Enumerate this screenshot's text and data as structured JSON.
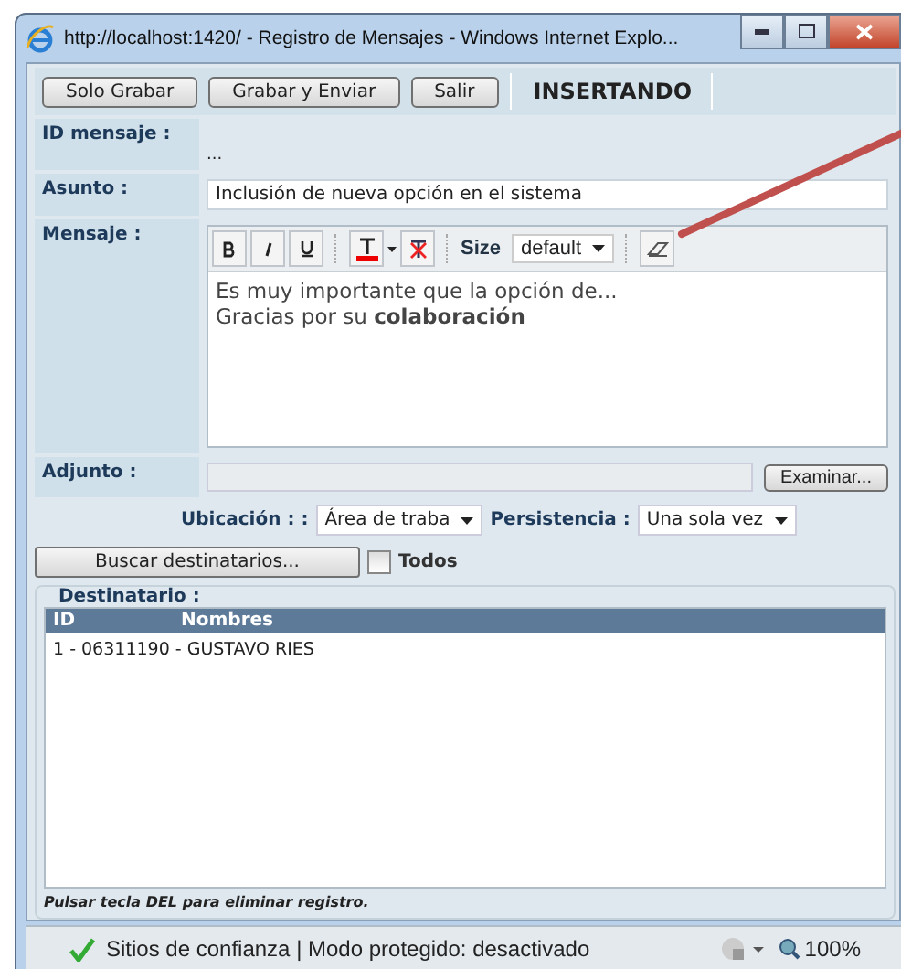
{
  "window": {
    "title": "http://localhost:1420/ - Registro de Mensajes - Windows Internet Explo..."
  },
  "toolbar": {
    "buttons": [
      "Solo Grabar",
      "Grabar y Enviar",
      "Salir"
    ],
    "mode": "INSERTANDO"
  },
  "fields": [
    {
      "label": "ID mensaje :",
      "kind": "text",
      "value": "..."
    },
    {
      "label": "Asunto :",
      "kind": "input",
      "value": "Inclusión de nueva opción en el sistema"
    },
    {
      "label": "Mensaje :",
      "kind": "editor",
      "size_label": "Size",
      "size_value": "default",
      "lines": [
        "Es muy importante que la opción de...",
        "Gracias por su **colaboración**"
      ]
    },
    {
      "label": "Adjunto :",
      "kind": "file",
      "button": "Examinar..."
    }
  ],
  "options": [
    {
      "label": "Ubicación : :",
      "value": "Área de traba"
    },
    {
      "label": "Persistencia :",
      "value": "Una sola vez"
    }
  ],
  "search": {
    "button": "Buscar destinatarios...",
    "all": {
      "label": "Todos",
      "checked": false
    }
  },
  "recipients": {
    "legend": "Destinatario :",
    "columns": [
      "ID",
      "Nombres"
    ],
    "rows": [
      "1 - 06311190 - GUSTAVO RIES"
    ],
    "hint": "Pulsar tecla DEL para eliminar registro."
  },
  "status_bar": {
    "text": "Sitios de confianza | Modo protegido: desactivado",
    "zoom": "100%"
  }
}
